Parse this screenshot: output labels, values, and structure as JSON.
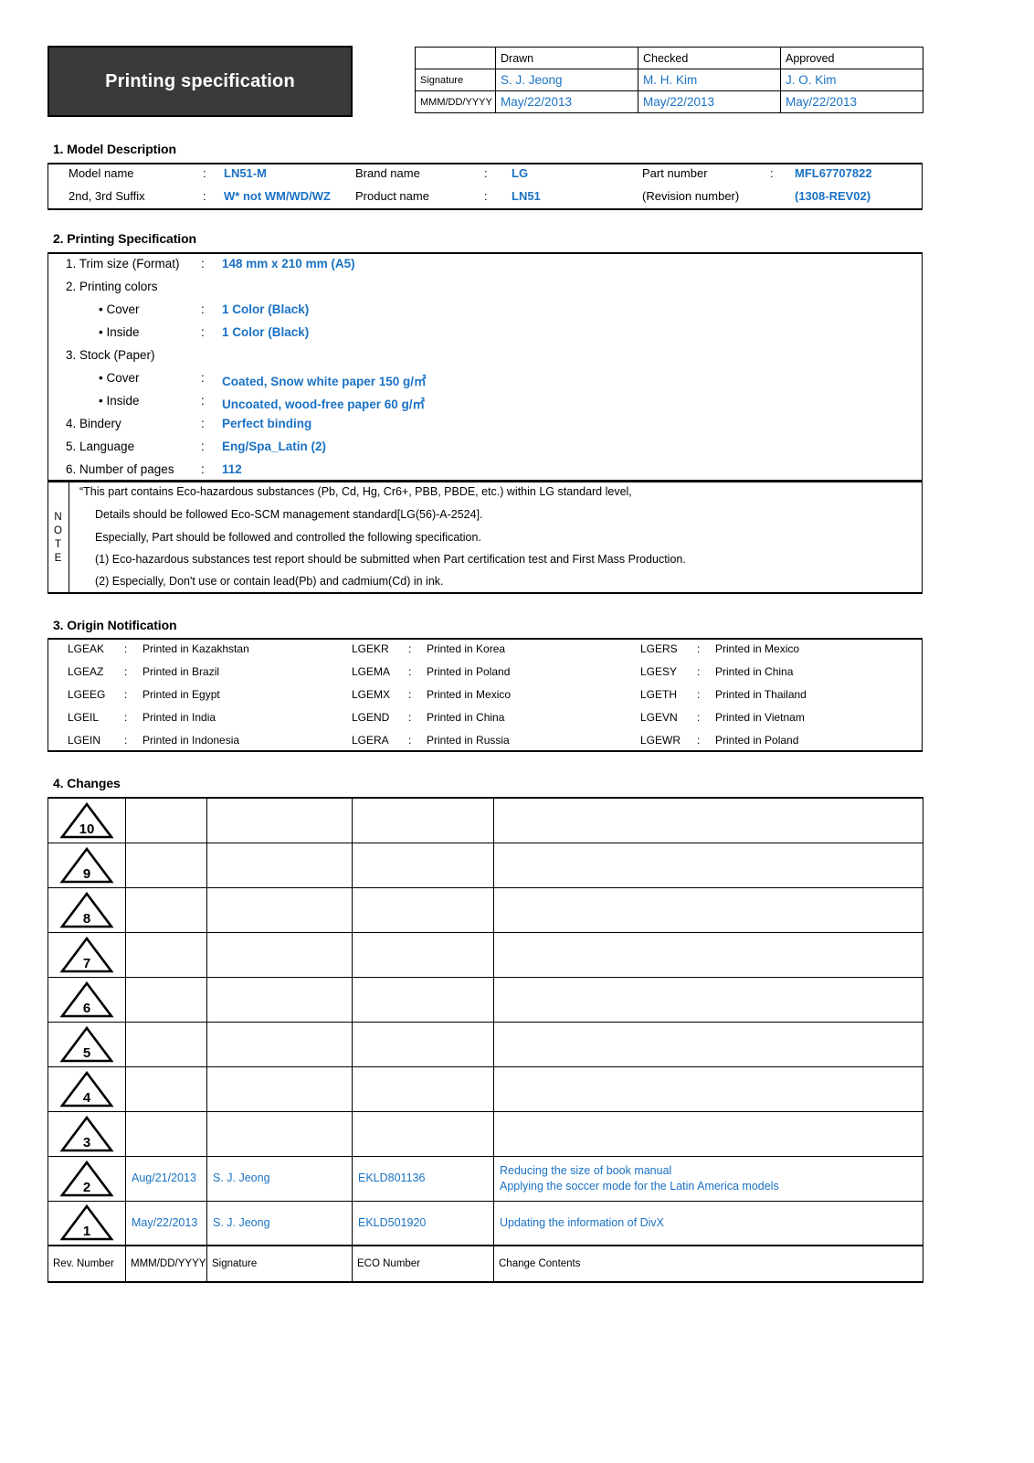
{
  "header": {
    "title": "Printing specification",
    "signature_table": {
      "col_headers": [
        "",
        "Drawn",
        "Checked",
        "Approved"
      ],
      "rows": [
        {
          "label": "Signature",
          "values": [
            "S. J. Jeong",
            "M. H. Kim",
            "J. O. Kim"
          ]
        },
        {
          "label": "MMM/DD/YYYY",
          "values": [
            "May/22/2013",
            "May/22/2013",
            "May/22/2013"
          ]
        }
      ]
    }
  },
  "section1": {
    "heading": "1. Model Description",
    "colon": ":",
    "fields": [
      {
        "label": "Model name",
        "value": "LN51-M"
      },
      {
        "label": "Brand name",
        "value": "LG"
      },
      {
        "label": "Part number",
        "value": "MFL67707822"
      },
      {
        "label": "2nd, 3rd Suffix",
        "value": "W* not WM/WD/WZ"
      },
      {
        "label": "Product name",
        "value": "LN51"
      },
      {
        "label": "(Revision number)",
        "value": "(1308-REV02)"
      }
    ]
  },
  "section2": {
    "heading": "2. Printing Specification",
    "colon": ":",
    "items": [
      {
        "label": "1. Trim size (Format)",
        "value": "148 mm x 210 mm (A5)"
      },
      {
        "label": "2. Printing colors",
        "value": ""
      },
      {
        "label": "• Cover",
        "value": "1 Color (Black)"
      },
      {
        "label": "• Inside",
        "value": "1 Color (Black)"
      },
      {
        "label": "3. Stock (Paper)",
        "value": ""
      },
      {
        "label": "• Cover",
        "value": "Coated, Snow white paper 150 g/㎡"
      },
      {
        "label": "• Inside",
        "value": "Uncoated, wood-free paper 60 g/㎡"
      },
      {
        "label": "4. Bindery",
        "value": "Perfect binding"
      },
      {
        "label": "5. Language",
        "value": "Eng/Spa_Latin (2)"
      },
      {
        "label": "6. Number of pages",
        "value": "112"
      }
    ]
  },
  "note": {
    "side_label": "NOTE",
    "lines": [
      "“This part contains Eco-hazardous substances (Pb, Cd, Hg, Cr6+, PBB, PBDE, etc.) within LG standard level,",
      "Details should be followed Eco-SCM management standard[LG(56)-A-2524].",
      "Especially, Part should be followed and controlled the following specification.",
      "(1) Eco-hazardous substances test report should be submitted when Part certification test and First Mass Production.",
      "(2) Especially, Don't use or contain lead(Pb) and cadmium(Cd) in ink."
    ]
  },
  "section3": {
    "heading": "3. Origin Notification",
    "colon": ":",
    "column1": [
      {
        "code": "LGEAK",
        "text": "Printed in Kazakhstan"
      },
      {
        "code": "LGEAZ",
        "text": "Printed in Brazil"
      },
      {
        "code": "LGEEG",
        "text": "Printed in Egypt"
      },
      {
        "code": "LGEIL",
        "text": "Printed in India"
      },
      {
        "code": "LGEIN",
        "text": "Printed in Indonesia"
      }
    ],
    "column2": [
      {
        "code": "LGEKR",
        "text": "Printed in Korea"
      },
      {
        "code": "LGEMA",
        "text": "Printed in Poland"
      },
      {
        "code": "LGEMX",
        "text": "Printed in Mexico"
      },
      {
        "code": "LGEND",
        "text": "Printed in China"
      },
      {
        "code": "LGERA",
        "text": "Printed in Russia"
      }
    ],
    "column3": [
      {
        "code": "LGERS",
        "text": "Printed in Mexico"
      },
      {
        "code": "LGESY",
        "text": "Printed in China"
      },
      {
        "code": "LGETH",
        "text": "Printed in Thailand"
      },
      {
        "code": "LGEVN",
        "text": "Printed in Vietnam"
      },
      {
        "code": "LGEWR",
        "text": "Printed in Poland"
      }
    ]
  },
  "section4": {
    "heading": "4. Changes",
    "rows": [
      {
        "rev": "10",
        "date": "",
        "signature": "",
        "eco": "",
        "contents": ""
      },
      {
        "rev": "9",
        "date": "",
        "signature": "",
        "eco": "",
        "contents": ""
      },
      {
        "rev": "8",
        "date": "",
        "signature": "",
        "eco": "",
        "contents": ""
      },
      {
        "rev": "7",
        "date": "",
        "signature": "",
        "eco": "",
        "contents": ""
      },
      {
        "rev": "6",
        "date": "",
        "signature": "",
        "eco": "",
        "contents": ""
      },
      {
        "rev": "5",
        "date": "",
        "signature": "",
        "eco": "",
        "contents": ""
      },
      {
        "rev": "4",
        "date": "",
        "signature": "",
        "eco": "",
        "contents": ""
      },
      {
        "rev": "3",
        "date": "",
        "signature": "",
        "eco": "",
        "contents": ""
      },
      {
        "rev": "2",
        "date": "Aug/21/2013",
        "signature": "S. J. Jeong",
        "eco": "EKLD801136",
        "contents": "Reducing the size of book manual\nApplying the soccer mode for the Latin America models"
      },
      {
        "rev": "1",
        "date": "May/22/2013",
        "signature": "S. J. Jeong",
        "eco": "EKLD501920",
        "contents": "Updating the information of DivX"
      }
    ],
    "footer": [
      "Rev. Number",
      "MMM/DD/YYYY",
      "Signature",
      "ECO Number",
      "Change Contents"
    ]
  },
  "colors": {
    "accent_blue": "#1a72c4",
    "title_block_bg": "#3a3a3a",
    "rule": "#000000"
  }
}
